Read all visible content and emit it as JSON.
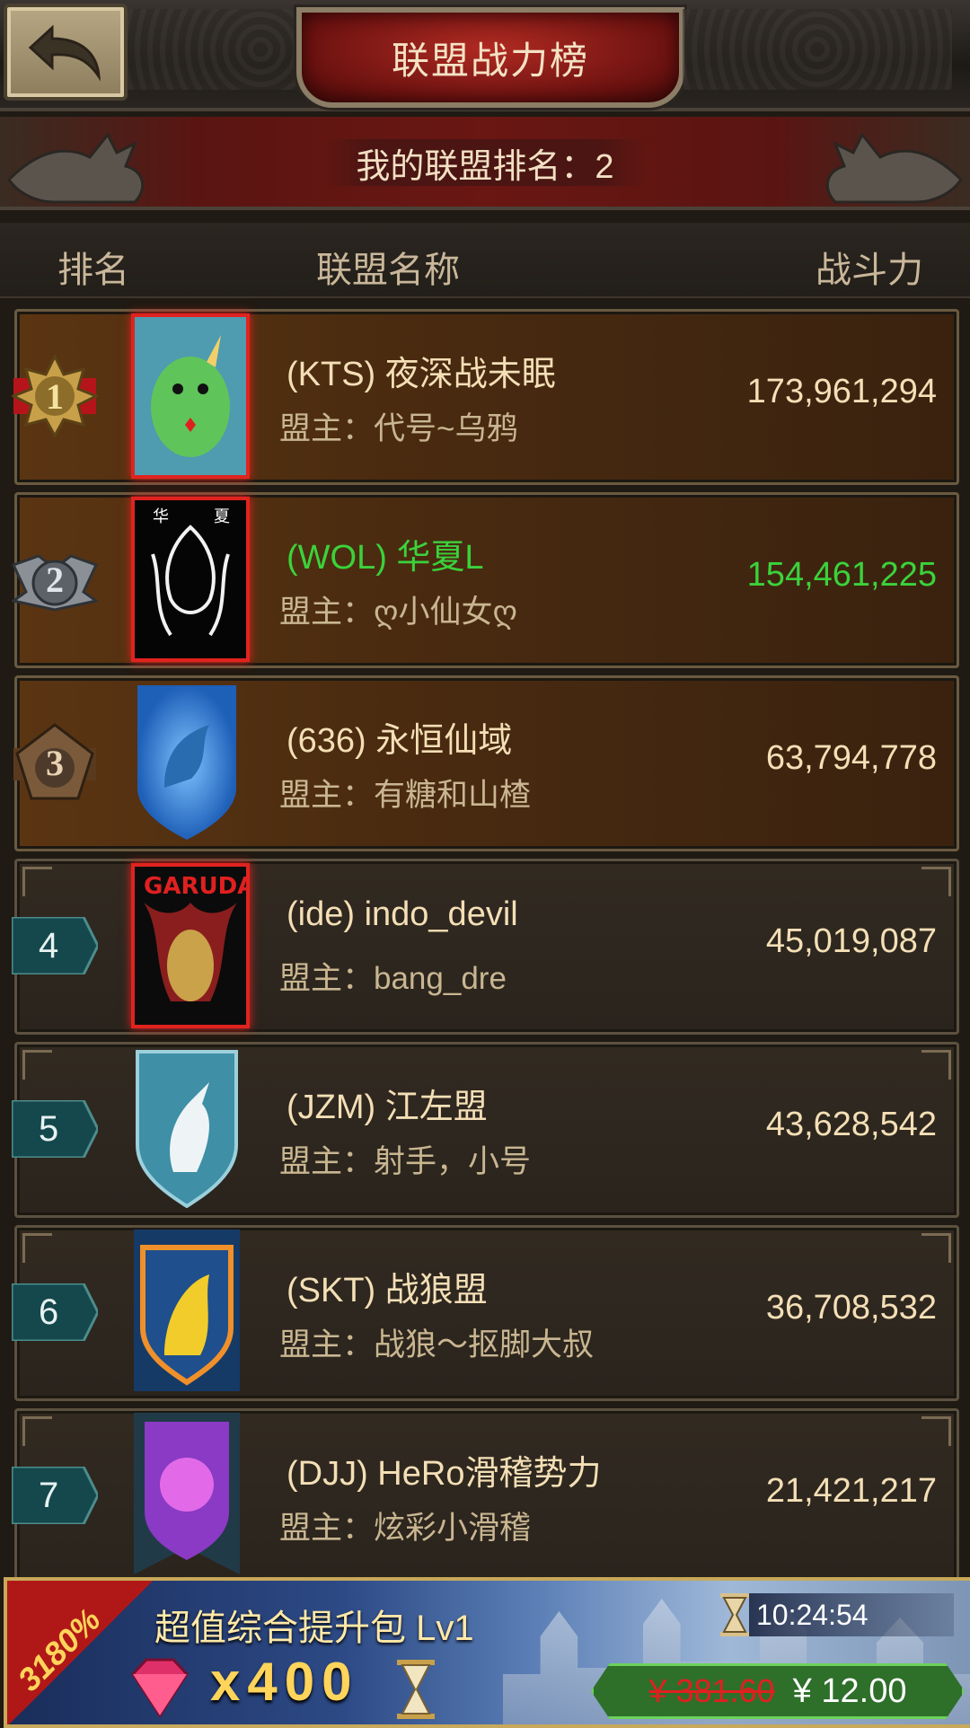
{
  "header": {
    "title": "联盟战力榜",
    "back_icon": "back-arrow-icon"
  },
  "my_rank": {
    "label": "我的联盟排名：2"
  },
  "columns": {
    "rank": "排名",
    "name": "联盟名称",
    "power": "战斗力"
  },
  "rows": [
    {
      "rank": "1",
      "name": "(KTS) 夜深战未眠",
      "leader": "盟主：代号~乌鸦",
      "power": "173,961,294",
      "emblem": "green-dragon-avatar"
    },
    {
      "rank": "2",
      "name": "(WOL) 华夏L",
      "leader": "盟主：ღ小仙女ღ",
      "power": "154,461,225",
      "emblem": "black-dragon-crest",
      "highlight": true,
      "highlight_color": "#3bd23b"
    },
    {
      "rank": "3",
      "name": "(636) 永恒仙域",
      "leader": "盟主：有糖和山楂",
      "power": "63,794,778",
      "emblem": "blue-griffin-shield"
    },
    {
      "rank": "4",
      "name": "(ide) indo_devil",
      "leader": "盟主：bang_dre",
      "power": "45,019,087",
      "emblem": "garuda-avatar"
    },
    {
      "rank": "5",
      "name": "(JZM) 江左盟",
      "leader": "盟主：射手，小号",
      "power": "43,628,542",
      "emblem": "unicorn-shield"
    },
    {
      "rank": "6",
      "name": "(SKT) 战狼盟",
      "leader": "盟主：战狼～抠脚大叔",
      "power": "36,708,532",
      "emblem": "lion-shield"
    },
    {
      "rank": "7",
      "name": "(DJJ) HeRo滑稽势力",
      "leader": "盟主：炫彩小滑稽",
      "power": "21,421,217",
      "emblem": "purple-beast-banner"
    }
  ],
  "promo": {
    "percent": "3180%",
    "title": "超值综合提升包 Lv1",
    "gem_count": "x400",
    "timer": "10:24:54",
    "price_old": "¥ 381.60",
    "price_new": "¥ 12.00"
  },
  "colors": {
    "accent_red": "#b02a22",
    "highlight_green": "#3bd23b",
    "gold_text": "#f4dfb6"
  }
}
